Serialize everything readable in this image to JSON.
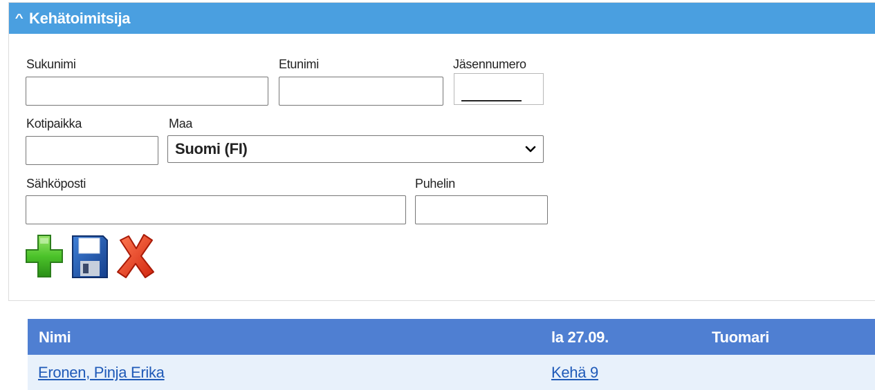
{
  "panel": {
    "title": "Kehätoimitsija",
    "collapse_icon": "chevron-up-icon"
  },
  "form": {
    "surname_label": "Sukunimi",
    "surname_value": "",
    "firstname_label": "Etunimi",
    "firstname_value": "",
    "member_number_label": "Jäsennumero",
    "member_number_value": "",
    "hometown_label": "Kotipaikka",
    "hometown_value": "",
    "country_label": "Maa",
    "country_selected": "Suomi (FI)",
    "email_label": "Sähköposti",
    "email_value": "",
    "phone_label": "Puhelin",
    "phone_value": ""
  },
  "actions": {
    "add_icon": "plus-icon",
    "save_icon": "floppy-disk-icon",
    "delete_icon": "red-x-icon"
  },
  "table": {
    "columns": [
      "Nimi",
      "la 27.09.",
      "Tuomari"
    ],
    "rows": [
      {
        "name": "Eronen, Pinja Erika",
        "day": "Kehä 9",
        "judge": ""
      }
    ]
  },
  "colors": {
    "panel_header": "#4a9fe0",
    "table_header": "#4f7fd2",
    "table_row": "#e8f1fb",
    "link": "#1f5ab8"
  }
}
